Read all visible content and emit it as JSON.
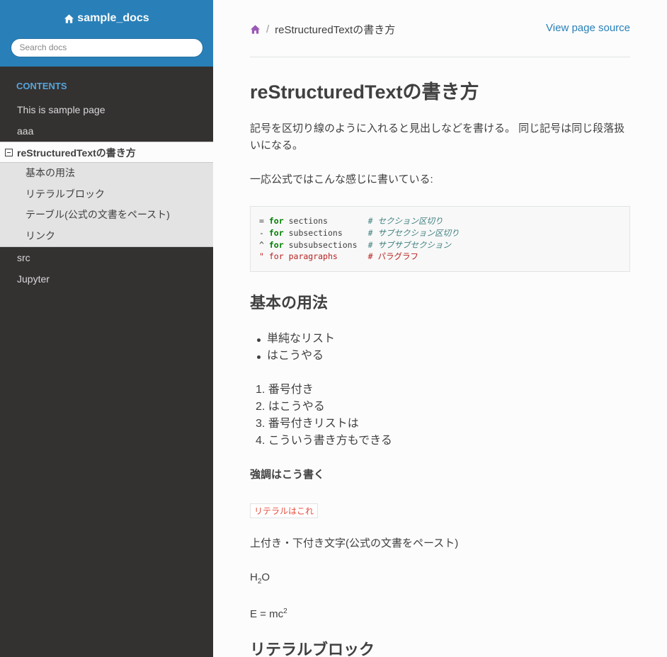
{
  "sidebar": {
    "project_name": "sample_docs",
    "search_placeholder": "Search docs",
    "caption": "CONTENTS",
    "items_before": [
      "This is sample page",
      "aaa"
    ],
    "current_item": "reStructuredTextの書き方",
    "sub_items": [
      "基本の用法",
      "リテラルブロック",
      "テーブル(公式の文書をペースト)",
      "リンク"
    ],
    "items_after": [
      "src",
      "Jupyter"
    ]
  },
  "breadcrumb": {
    "current": "reStructuredTextの書き方",
    "separator": "/"
  },
  "view_source": "View page source",
  "main": {
    "title": "reStructuredTextの書き方",
    "intro": "記号を区切り線のように入れると見出しなどを書ける。 同じ記号は同じ段落扱いになる。",
    "official_note": "一応公式ではこんな感じに書いている:",
    "code_lines": [
      {
        "sym": "=",
        "kw": "for",
        "text": "sections",
        "comment": "# セクション区切り"
      },
      {
        "sym": "-",
        "kw": "for",
        "text": "subsections",
        "comment": "# サブセクション区切り"
      },
      {
        "sym": "^",
        "kw": "for",
        "text": "subsubsections",
        "comment": "# サブサブセクション"
      },
      {
        "sym": "\"",
        "kw": "for",
        "text": "paragraphs",
        "comment": "# パラグラフ"
      }
    ],
    "section1_title": "基本の用法",
    "bullets": [
      "単純なリスト",
      "はこうやる"
    ],
    "numbered": [
      "1. 番号付き",
      "2. はこうやる",
      "3. 番号付きリストは",
      "4. こういう書き方もできる"
    ],
    "strong_text": "強調はこう書く",
    "literal_text": "リテラルはこれ",
    "supsub_note": "上付き・下付き文字(公式の文書をペースト)",
    "h2o": {
      "base": "H",
      "sub": "2",
      "tail": "O"
    },
    "emc": {
      "base": "E = mc",
      "sup": "2"
    },
    "section2_title": "リテラルブロック"
  },
  "colors": {
    "sidebar_bg": "#343131",
    "sidebar_head": "#2980b9",
    "caption": "#55a5d9",
    "link": "#2980b9",
    "home_icon": "#9b59b6",
    "literal": "#e74c3c"
  }
}
